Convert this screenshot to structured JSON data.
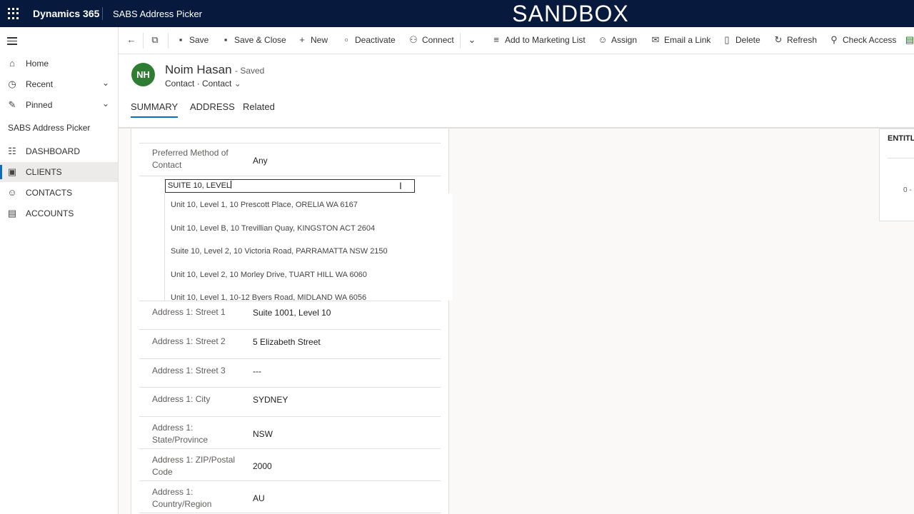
{
  "topbar": {
    "brand": "Dynamics 365",
    "app_name": "SABS Address Picker",
    "environment": "SANDBOX"
  },
  "sidebar": {
    "items": [
      {
        "label": "Home"
      },
      {
        "label": "Recent"
      },
      {
        "label": "Pinned"
      }
    ],
    "section_title": "SABS Address Picker",
    "section_items": [
      {
        "label": "DASHBOARD"
      },
      {
        "label": "CLIENTS"
      },
      {
        "label": "CONTACTS"
      },
      {
        "label": "ACCOUNTS"
      }
    ]
  },
  "commandbar": {
    "save": "Save",
    "save_close": "Save & Close",
    "new": "New",
    "deactivate": "Deactivate",
    "connect": "Connect",
    "add_marketing": "Add to Marketing List",
    "assign": "Assign",
    "email_link": "Email a Link",
    "delete": "Delete",
    "refresh": "Refresh",
    "check_access": "Check Access"
  },
  "record": {
    "initials": "NH",
    "name": "Noim Hasan",
    "saved": "- Saved",
    "type": "Contact · Contact"
  },
  "tabs": [
    {
      "label": "SUMMARY"
    },
    {
      "label": "ADDRESS"
    },
    {
      "label": "Related"
    }
  ],
  "form": {
    "pref_label": "Preferred Method of Contact",
    "pref_value": "Any",
    "address_input_value": "SUITE 10, LEVEL",
    "suggestions": [
      "Unit 10, Level 1, 10 Prescott Place, ORELIA WA 6167",
      "Unit 10, Level B, 10 Trevillian Quay, KINGSTON ACT 2604",
      "Suite 10, Level 2, 10 Victoria Road, PARRAMATTA NSW 2150",
      "Unit 10, Level 2, 10 Morley Drive, TUART HILL WA 6060",
      "Unit 10, Level 1, 10-12 Byers Road, MIDLAND WA 6056"
    ],
    "fields": [
      {
        "label": "Address 1: Street 1",
        "value": "Suite 1001, Level 10"
      },
      {
        "label": "Address 1: Street 2",
        "value": "5 Elizabeth Street"
      },
      {
        "label": "Address 1: Street 3",
        "value": "---"
      },
      {
        "label": "Address 1: City",
        "value": "SYDNEY"
      },
      {
        "label": "Address 1: State/Province",
        "value": "NSW"
      },
      {
        "label": "Address 1: ZIP/Postal Code",
        "value": "2000"
      },
      {
        "label": "Address 1: Country/Region",
        "value": "AU"
      }
    ]
  },
  "side_card": {
    "title": "ENTITL",
    "value": "0 -"
  }
}
